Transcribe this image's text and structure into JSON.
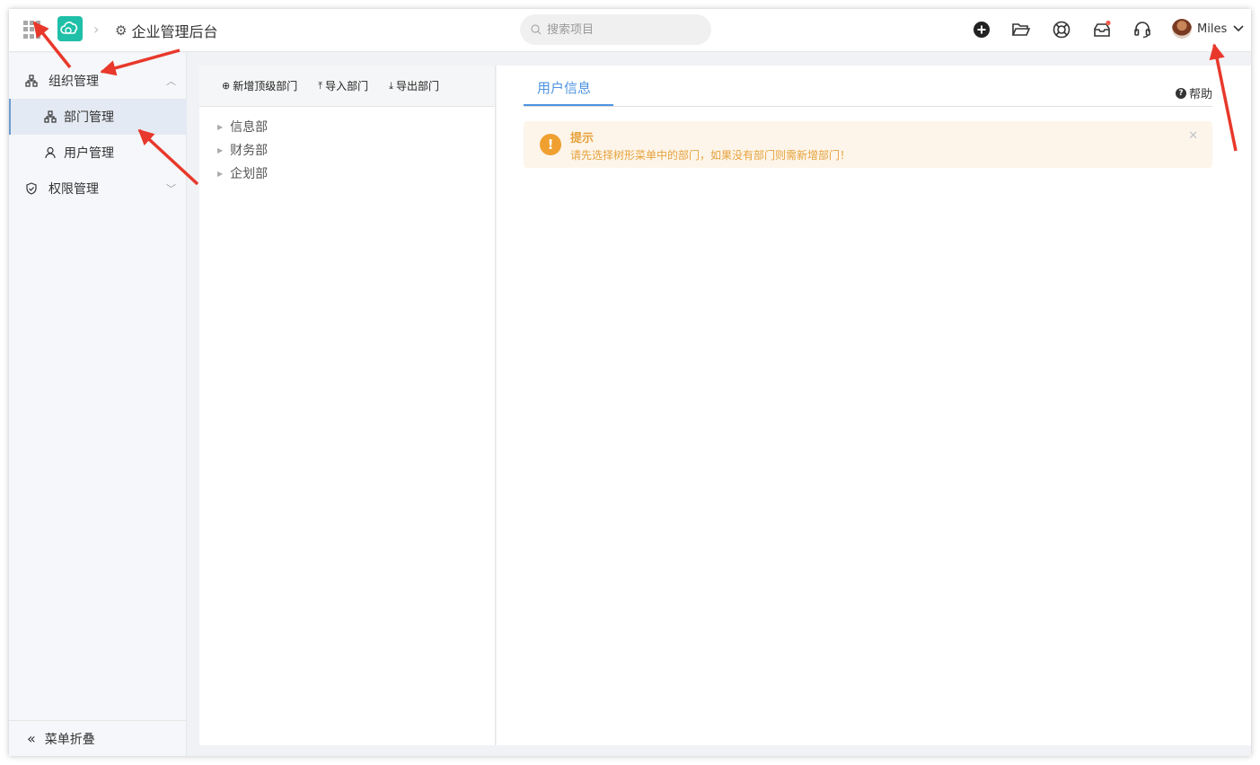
{
  "header": {
    "app_title": "企业管理后台",
    "search_placeholder": "搜索项目",
    "user_name": "Miles",
    "notification_dot_color": "#f25c4d",
    "icons": [
      "apps-grid-icon",
      "cloud-logo-icon",
      "gear-icon",
      "add-circle-icon",
      "folder-open-icon",
      "lifebuoy-icon",
      "inbox-icon",
      "headset-icon",
      "chevron-down-icon"
    ]
  },
  "sidebar": {
    "items": [
      {
        "label": "组织管理",
        "icon": "org-icon",
        "expanded": true
      },
      {
        "label": "部门管理",
        "icon": "org-icon",
        "active": true
      },
      {
        "label": "用户管理",
        "icon": "user-icon"
      },
      {
        "label": "权限管理",
        "icon": "shield-icon",
        "expanded": false
      }
    ],
    "collapse_label": "菜单折叠"
  },
  "dept": {
    "toolbar": {
      "add_top": "新增顶级部门",
      "import": "导入部门",
      "export": "导出部门"
    },
    "tree": [
      "信息部",
      "财务部",
      "企划部"
    ]
  },
  "info": {
    "tab": "用户信息",
    "help": "帮助",
    "alert": {
      "title": "提示",
      "text": "请先选择树形菜单中的部门，如果没有部门则需新增部门！"
    }
  },
  "colors": {
    "accent": "#4d93e1",
    "warning": "#e6a23c",
    "logo": "#1fbfa8",
    "annotation_arrow": "#e8382b"
  }
}
